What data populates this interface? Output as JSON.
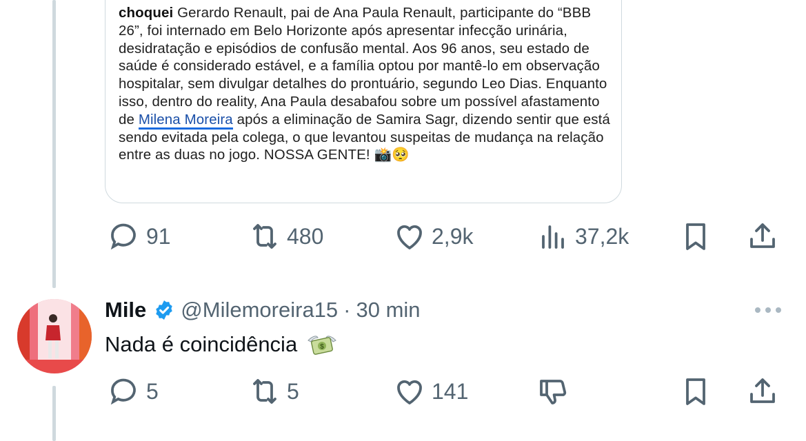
{
  "quoted_post": {
    "source": "choquei",
    "text_before_mention": " Gerardo Renault, pai de Ana Paula Renault, participante do “BBB 26”, foi internado em Belo Horizonte após apresentar infecção urinária, desidratação e episódios de confusão mental. Aos 96 anos, seu estado de saúde é considerado estável, e a família optou por mantê-lo em observação hospitalar, sem divulgar detalhes do prontuário, segundo Leo Dias. Enquanto isso, dentro do reality, Ana Paula desabafou sobre um possível afastamento de ",
    "mention": "Milena Moreira",
    "text_after_mention": " após a eliminação de Samira Sagr, dizendo sentir que está sendo evitada pela colega, o que levantou suspeitas de mudança na relação entre as duas no jogo. NOSSA GENTE!",
    "emojis": "📸🥺"
  },
  "main_actions": {
    "replies": "91",
    "reposts": "480",
    "likes": "2,9k",
    "views": "37,2k"
  },
  "reply": {
    "display_name": "Mile",
    "handle": "@Milemoreira15",
    "separator": "·",
    "time": "30 min",
    "text": "Nada é coincidência",
    "emoji_name": "money-with-wings",
    "actions": {
      "replies": "5",
      "reposts": "5",
      "likes": "141"
    }
  },
  "colors": {
    "accent": "#1d9bf0",
    "muted": "#536471",
    "border": "#cfd9de"
  }
}
